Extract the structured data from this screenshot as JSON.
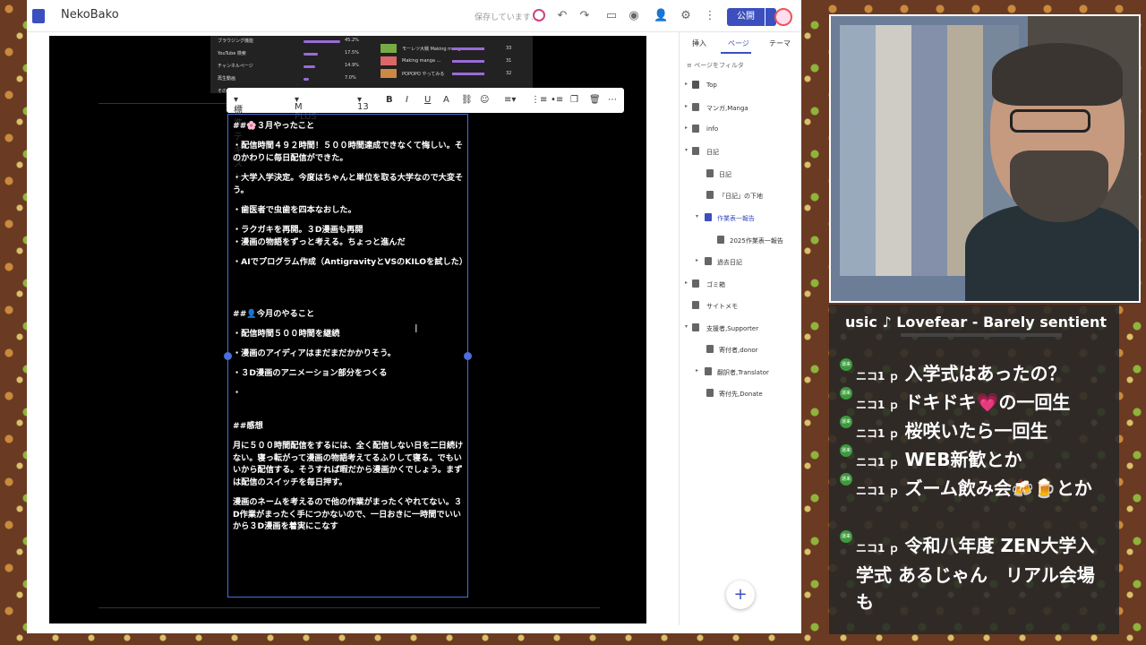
{
  "app": {
    "name": "NekoBako",
    "save_status": "保存しています…",
    "publish_label": "公開"
  },
  "thumbnail": {
    "stats": [
      {
        "label": "ブラウジング機能",
        "pct": "45.2%",
        "fill": 0.452
      },
      {
        "label": "YouTube 検索",
        "pct": "17.5%",
        "fill": 0.175
      },
      {
        "label": "チャンネルページ",
        "pct": "14.9%",
        "fill": 0.149
      },
      {
        "label": "再生動画",
        "pct": "7.0%",
        "fill": 0.07
      },
      {
        "label": "その他のYouTube機能",
        "pct": "",
        "fill": 0
      }
    ],
    "videos": [
      {
        "title": "モーレツ大戦 Making mang...",
        "count": "33"
      },
      {
        "title": "Making manga ...",
        "count": "31"
      },
      {
        "title": "POPOPO やってみる",
        "count": "32"
      }
    ]
  },
  "format_toolbar": {
    "style": "標準テキスト",
    "font": "M PLUS Rou",
    "size": "13"
  },
  "document": {
    "heading1": "##🌸３月やったこと",
    "p1": "・配信時間４９２時間！５００時間達成できなくて悔しい。そのかわりに毎日配信ができた。",
    "p2": "・大学入学決定。今度はちゃんと単位を取る大学なので大変そう。",
    "p3": "・歯医者で虫歯を四本なおした。",
    "p4": "・ラクガキを再開。３D漫画も再開",
    "p5": "・漫画の物語をずっと考える。ちょっと進んだ",
    "p6": "・AIでプログラム作成（AntigravityとVSのKILOを試した）",
    "heading2": "##👤今月のやること",
    "p7": "・配信時間５００時間を継続",
    "p8": "・漫画のアイディアはまだまだかかりそう。",
    "p9": "・３D漫画のアニメーション部分をつくる",
    "p10": "・",
    "heading3": "##感想",
    "p11": "月に５００時間配信をするには、全く配信しない日を二日続けない。寝っ転がって漫画の物語考えてるふりして寝る。でもいいから配信する。そうすれば暇だから漫画かくでしょう。まずは配信のスイッチを毎日押す。",
    "p12": "漫画のネームを考えるので他の作業がまったくやれてない。３D作業がまったく手につかないので、一日おきに一時間でいいから３D漫画を着実にこなす"
  },
  "sidebar": {
    "tabs": [
      "挿入",
      "ページ",
      "テーマ"
    ],
    "filter_placeholder": "ページをフィルタ",
    "items": [
      {
        "label": "Top"
      },
      {
        "label": "マンガ,Manga"
      },
      {
        "label": "info"
      },
      {
        "label": "日記"
      },
      {
        "label": "日記"
      },
      {
        "label": "「日記」の下地"
      },
      {
        "label": "作業表一報告"
      },
      {
        "label": "2025作業表一報告"
      },
      {
        "label": "過去日記"
      },
      {
        "label": "ゴミ箱"
      },
      {
        "label": "サイトメモ"
      },
      {
        "label": "支援者,Supporter"
      },
      {
        "label": "寄付者,donor"
      },
      {
        "label": "翻訳者,Translator"
      },
      {
        "label": "寄付先,Donate"
      }
    ]
  },
  "overlay": {
    "music": "usic ♪ Lovefear - Barely sentient",
    "badge": "運来",
    "messages": [
      {
        "user": "ニコ1 ｐ",
        "text": "入学式はあったの？"
      },
      {
        "user": "ニコ1 ｐ",
        "text": "ドキドキ💗の一回生"
      },
      {
        "user": "ニコ1 ｐ",
        "text": "桜咲いたら一回生"
      },
      {
        "user": "ニコ1 ｐ",
        "text": "WEB新歓とか"
      },
      {
        "user": "ニコ1 ｐ",
        "text": "ズーム飲み会🍻🍺とか"
      },
      {
        "user": "ニコ1 ｐ",
        "text": "令和八年度 ZEN大学入学式 あるじゃん　リアル会場も"
      }
    ]
  },
  "colors": {
    "accent": "#3b4fbf",
    "selection": "#4a6edb",
    "badge": "#3c9a3c"
  }
}
